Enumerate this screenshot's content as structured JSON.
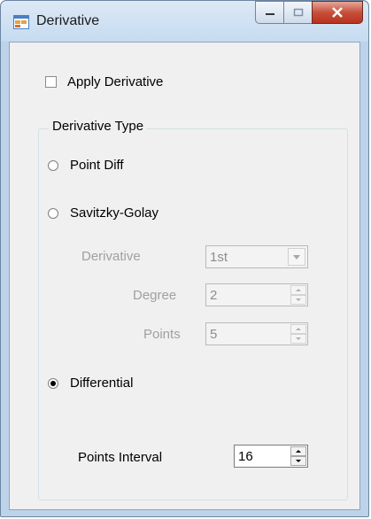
{
  "window": {
    "title": "Derivative",
    "icons": {
      "app": "form-icon",
      "minimize": "minimize-icon",
      "maximize": "maximize-icon",
      "close": "close-icon"
    }
  },
  "apply_derivative": {
    "label": "Apply Derivative",
    "checked": false
  },
  "derivative_type": {
    "legend": "Derivative Type",
    "options": [
      {
        "label": "Point Diff",
        "selected": false
      },
      {
        "label": "Savitzky-Golay",
        "selected": false
      },
      {
        "label": "Differential",
        "selected": true
      }
    ],
    "savitzky_golay": {
      "derivative_label": "Derivative",
      "derivative_value": "1st",
      "degree_label": "Degree",
      "degree_value": "2",
      "points_label": "Points",
      "points_value": "5"
    },
    "differential": {
      "points_interval_label": "Points Interval",
      "points_interval_value": "16"
    }
  }
}
